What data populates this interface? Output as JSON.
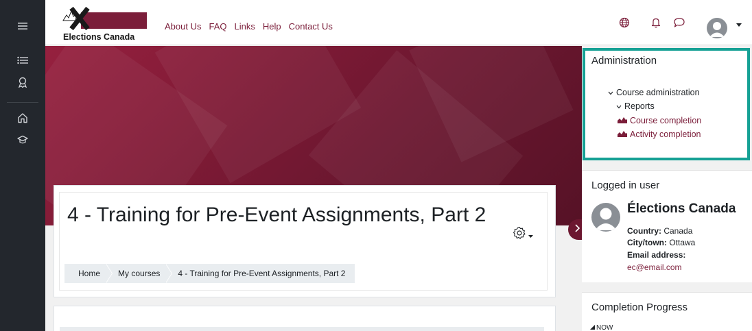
{
  "brand": {
    "logo_text": "Elections Canada"
  },
  "nav": {
    "links": [
      "About Us",
      "FAQ",
      "Links",
      "Help",
      "Contact Us"
    ]
  },
  "rail": {
    "icons": [
      "menu-icon",
      "list-icon",
      "badge-icon",
      "home-icon",
      "graduation-cap-icon"
    ]
  },
  "header_icons": [
    "globe-icon",
    "bell-icon",
    "chat-icon",
    "user-avatar-icon",
    "caret-down-icon"
  ],
  "course": {
    "title": "4 - Training for Pre-Event Assignments, Part 2",
    "breadcrumb": [
      "Home",
      "My courses",
      "4 - Training for Pre-Event Assignments, Part 2"
    ]
  },
  "admin": {
    "title": "Administration",
    "course_admin": "Course administration",
    "reports": "Reports",
    "course_completion": "Course completion",
    "activity_completion": "Activity completion"
  },
  "logged_in": {
    "title": "Logged in user",
    "name": "Élections Canada",
    "country_label": "Country:",
    "country": "Canada",
    "city_label": "City/town:",
    "city": "Ottawa",
    "email_label": "Email address:",
    "email": "ec@email.com"
  },
  "progress": {
    "title": "Completion Progress",
    "now_label": "NOW"
  },
  "colors": {
    "brand": "#7b1e3a",
    "rail": "#23272d",
    "highlight": "#16a195"
  }
}
